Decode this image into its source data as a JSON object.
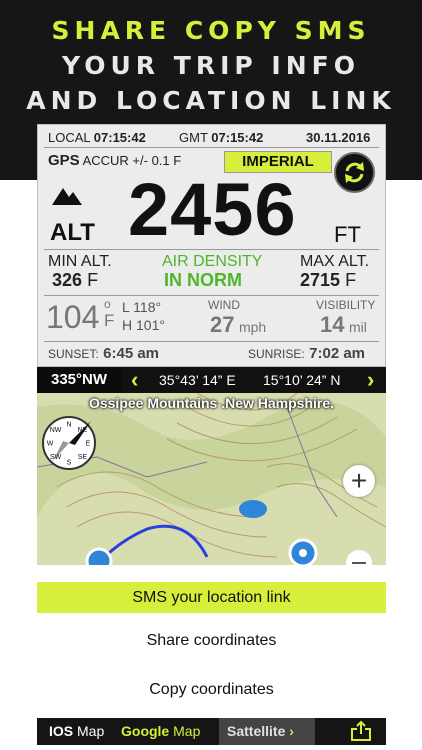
{
  "promo": {
    "line1": "SHARE COPY SMS",
    "line2": "YOUR TRIP INFO",
    "line3": "AND LOCATION LINK"
  },
  "panel": {
    "local_label": "LOCAL",
    "local_time": "07:15:42",
    "gmt_label": "GMT",
    "gmt_time": "07:15:42",
    "date": "30.11.2016",
    "gps_label": "GPS",
    "accuracy": "ACCUR +/- 0.1 F",
    "units_button": "IMPERIAL",
    "alt_label": "ALT",
    "altitude": "2456",
    "alt_unit": "FT",
    "min_alt_label": "MIN ALT.",
    "min_alt_value": "326",
    "min_alt_unit": "F",
    "air_density_label": "AIR DENSITY",
    "air_density_value": "IN NORM",
    "max_alt_label": "MAX ALT.",
    "max_alt_value": "2715",
    "max_alt_unit": "F",
    "temperature": "104",
    "temp_unit_top": "o",
    "temp_unit_bottom": "F",
    "low_label": "L",
    "low_value": "118°",
    "high_label": "H",
    "high_value": "101°",
    "wind_label": "WIND",
    "wind_value": "27",
    "wind_unit": "mph",
    "visibility_label": "VISIBILITY",
    "visibility_value": "14",
    "visibility_unit": "mil",
    "sunset_label": "SUNSET:",
    "sunset_time": "6:45 am",
    "sunrise_label": "SUNRISE:",
    "sunrise_time": "7:02 am"
  },
  "mapbar": {
    "heading": "335°NW",
    "prev": "‹",
    "latitude": "35°43’ 14” E",
    "longitude": "15°10’ 24” N",
    "next": "›"
  },
  "map": {
    "place_name": "Ossipee Mountains .New Hampshire.",
    "zoom_in": "+",
    "compass_letters": [
      "N",
      "NE",
      "E",
      "SE",
      "S",
      "SW",
      "W",
      "NW"
    ]
  },
  "actions": {
    "sms": "SMS your location link",
    "share": "Share coordinates",
    "copy": "Copy coordinates"
  },
  "bottom_bar": {
    "ios_bold": "IOS",
    "ios_light": "Map",
    "google_bold": "Google",
    "google_light": "Map",
    "satellite": "Sattellite",
    "chevron": "›"
  },
  "colors": {
    "accent": "#d7ef3a",
    "dark": "#161616",
    "green_value": "#4fb52b",
    "route_blue": "#2a3fe0",
    "lake_blue": "#2f86d8"
  }
}
